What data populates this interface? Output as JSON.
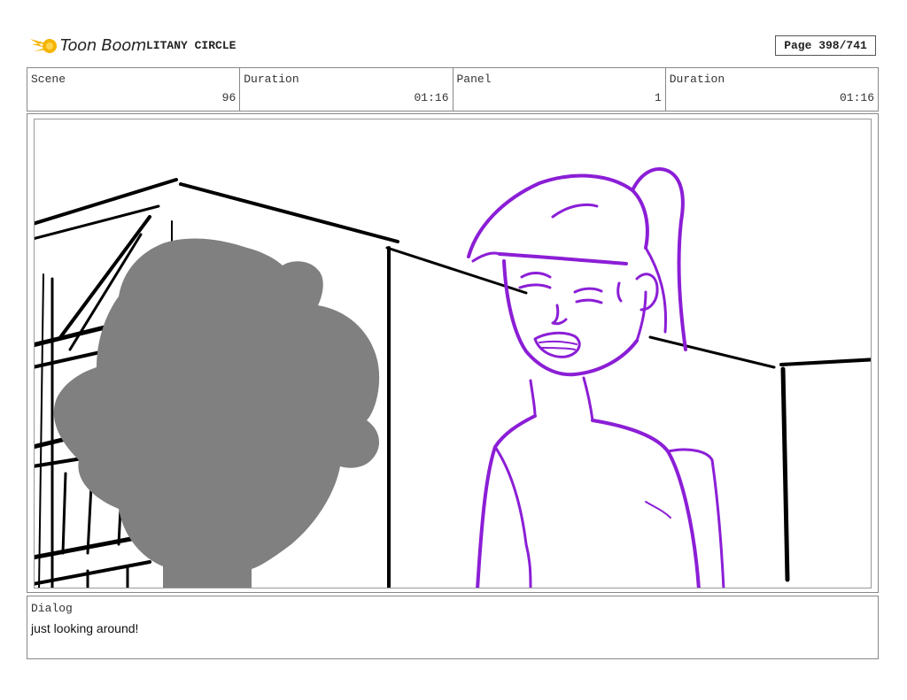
{
  "header": {
    "logo_text": "Toon Boom",
    "project_title": "LITANY CIRCLE",
    "page_label": "Page 398/741"
  },
  "info": {
    "scene_label": "Scene",
    "scene_value": "96",
    "scene_duration_label": "Duration",
    "scene_duration_value": "01:16",
    "panel_label": "Panel",
    "panel_value": "1",
    "panel_duration_label": "Duration",
    "panel_duration_value": "01:16"
  },
  "dialog": {
    "label": "Dialog",
    "text": "just looking around!"
  },
  "colors": {
    "logo_yellow": "#f4b400",
    "character_purple": "#8b1ed6",
    "silhouette_gray": "#808080",
    "line_black": "#000000"
  }
}
